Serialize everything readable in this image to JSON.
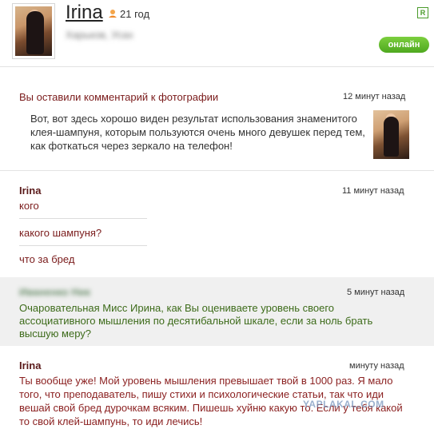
{
  "profile": {
    "name": "Irina",
    "age": "21 год",
    "location": "Харьков, Усах",
    "online_label": "онлайн",
    "corner_badge": "R"
  },
  "notice": {
    "title": "Вы оставили комментарий к фотографии",
    "time": "12 минут назад",
    "text": "Вот, вот здесь хорошо виден результат использования знаменитого клея-шампуня, которым пользуются очень много девушек перед тем, как фоткаться через зеркало на телефон!"
  },
  "reply1": {
    "author": "Irina",
    "time": "11 минут назад",
    "lines": [
      "кого",
      "какого шампуня?",
      "что за бред"
    ]
  },
  "reply2": {
    "author": "Иваненко Ник",
    "time": "5 минут назад",
    "text": "Очаровательная Мисс Ирина, как Вы оцениваете уровень своего ассоциативного мышления по десятибальной шкале, если за ноль брать высшую меру?"
  },
  "reply3": {
    "author": "Irina",
    "time": "минуту назад",
    "text": "Ты вообще уже! Мой уровень мышления превышает твой в 1000 раз. Я мало того, что преподаватель, пишу стихи и психологические статьи, так что иди вешай свой бред дурочкам всяким. Пишешь хуйню какую то. Если у тебя какой то свой клей-шампунь, то иди лечись!"
  },
  "watermark": "YAPLAKAL.COM",
  "colors": {
    "online": "#5dbb2a",
    "author": "#5a1a1a",
    "highlight_bg": "#f0f0f0",
    "green_text": "#3d6b1a"
  }
}
